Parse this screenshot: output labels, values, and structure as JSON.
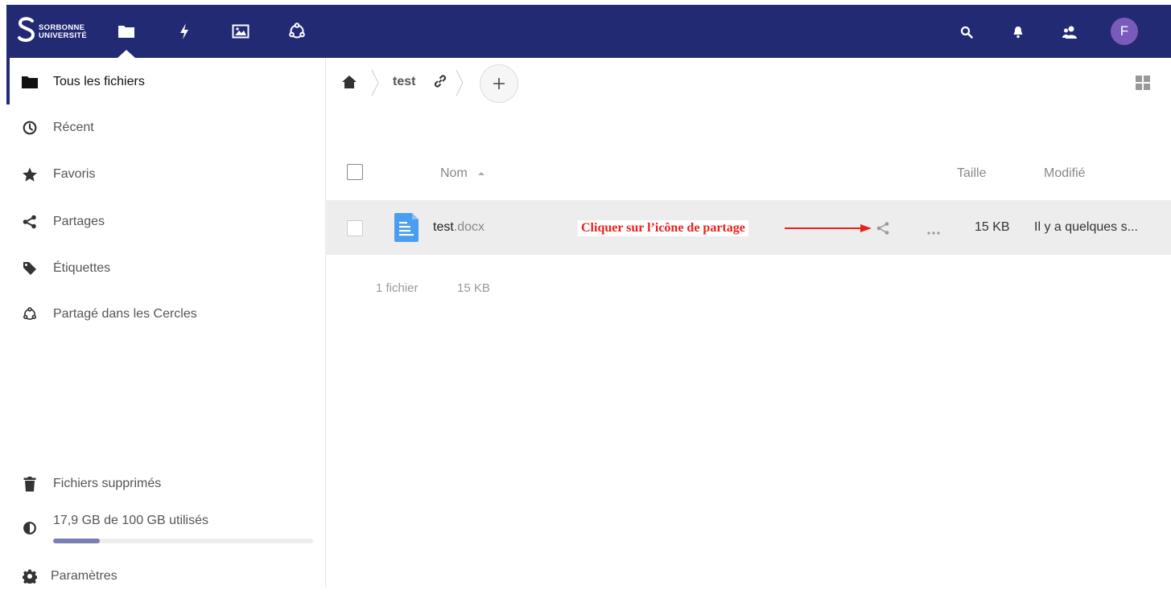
{
  "header": {
    "logo": {
      "line1": "SORBONNE",
      "line2": "UNIVERSITÉ"
    },
    "apps": [
      {
        "name": "files",
        "icon": "folder-icon"
      },
      {
        "name": "activity",
        "icon": "lightning-icon"
      },
      {
        "name": "photos",
        "icon": "image-icon"
      },
      {
        "name": "circles",
        "icon": "circles-icon"
      }
    ],
    "avatar_initial": "F",
    "colors": {
      "bar": "#232a74",
      "avatar": "#7a5bbb"
    }
  },
  "sidebar": {
    "items": [
      {
        "label": "Tous les fichiers",
        "icon": "folder-icon",
        "active": true
      },
      {
        "label": "Récent",
        "icon": "clock-icon"
      },
      {
        "label": "Favoris",
        "icon": "star-icon"
      },
      {
        "label": "Partages",
        "icon": "share-icon"
      },
      {
        "label": "Étiquettes",
        "icon": "tag-icon"
      },
      {
        "label": "Partagé dans les Cercles",
        "icon": "circles-icon"
      }
    ],
    "deleted_files": "Fichiers supprimés",
    "quota": {
      "label": "17,9 GB de 100 GB utilisés",
      "used_fraction": 0.179
    },
    "settings": "Paramètres"
  },
  "breadcrumb": {
    "folder": "test"
  },
  "table": {
    "headers": {
      "name": "Nom",
      "size": "Taille",
      "modified": "Modifié"
    },
    "rows": [
      {
        "base": "test",
        "ext": ".docx",
        "size": "15 KB",
        "modified": "Il y a quelques s...",
        "icon": "document-icon"
      }
    ],
    "summary": {
      "count": "1 fichier",
      "size": "15 KB"
    }
  },
  "annotation": {
    "text": "Cliquer sur l’icône de partage",
    "color": "#e8221b"
  }
}
